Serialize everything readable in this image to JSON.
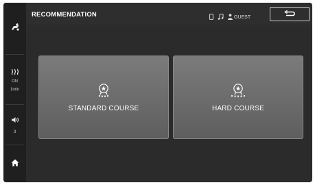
{
  "header": {
    "title": "RECOMMENDATION",
    "user_label": "GUEST"
  },
  "sidebar": {
    "heat_status": "ON",
    "heat_time": "1min",
    "volume_level": "3"
  },
  "courses": [
    {
      "label": "STANDARD COURSE",
      "icon": "award-medal-icon"
    },
    {
      "label": "HARD COURSE",
      "icon": "award-medal-icon"
    }
  ],
  "colors": {
    "background": "#2b2b2b",
    "sidebar": "#1f1f1f",
    "card": "#6f6f6f",
    "text": "#ffffff"
  }
}
